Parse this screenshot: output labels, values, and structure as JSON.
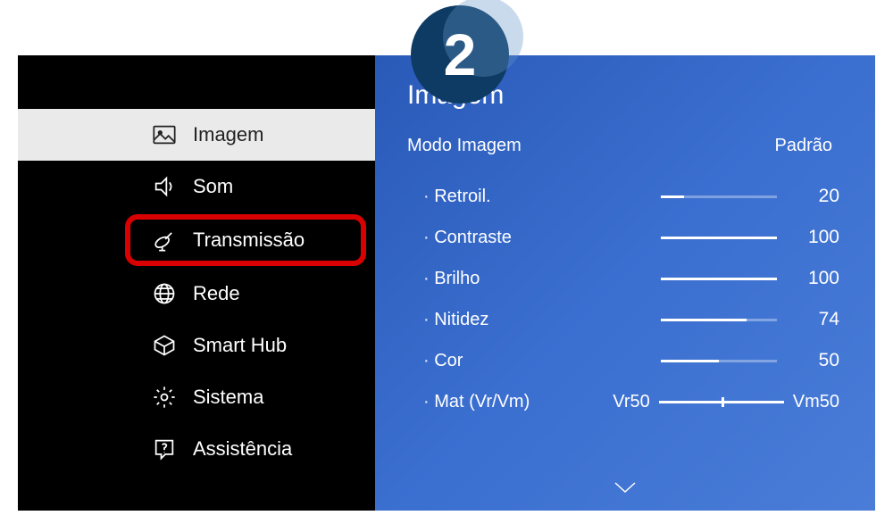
{
  "badge": {
    "number": "2"
  },
  "sidebar": {
    "items": [
      {
        "label": "Imagem",
        "active": true
      },
      {
        "label": "Som"
      },
      {
        "label": "Transmissão",
        "highlighted": true
      },
      {
        "label": "Rede"
      },
      {
        "label": "Smart Hub"
      },
      {
        "label": "Sistema"
      },
      {
        "label": "Assistência"
      }
    ]
  },
  "panel": {
    "title": "Imagem",
    "mode": {
      "label": "Modo Imagem",
      "value": "Padrão"
    },
    "settings": [
      {
        "label": "Retroil.",
        "value": "20",
        "percent": 20
      },
      {
        "label": "Contraste",
        "value": "100",
        "percent": 100
      },
      {
        "label": "Brilho",
        "value": "100",
        "percent": 100
      },
      {
        "label": "Nitidez",
        "value": "74",
        "percent": 74
      },
      {
        "label": "Cor",
        "value": "50",
        "percent": 50
      }
    ],
    "tint": {
      "label": "Mat (Vr/Vm)",
      "left": "Vr50",
      "right": "Vm50"
    }
  }
}
